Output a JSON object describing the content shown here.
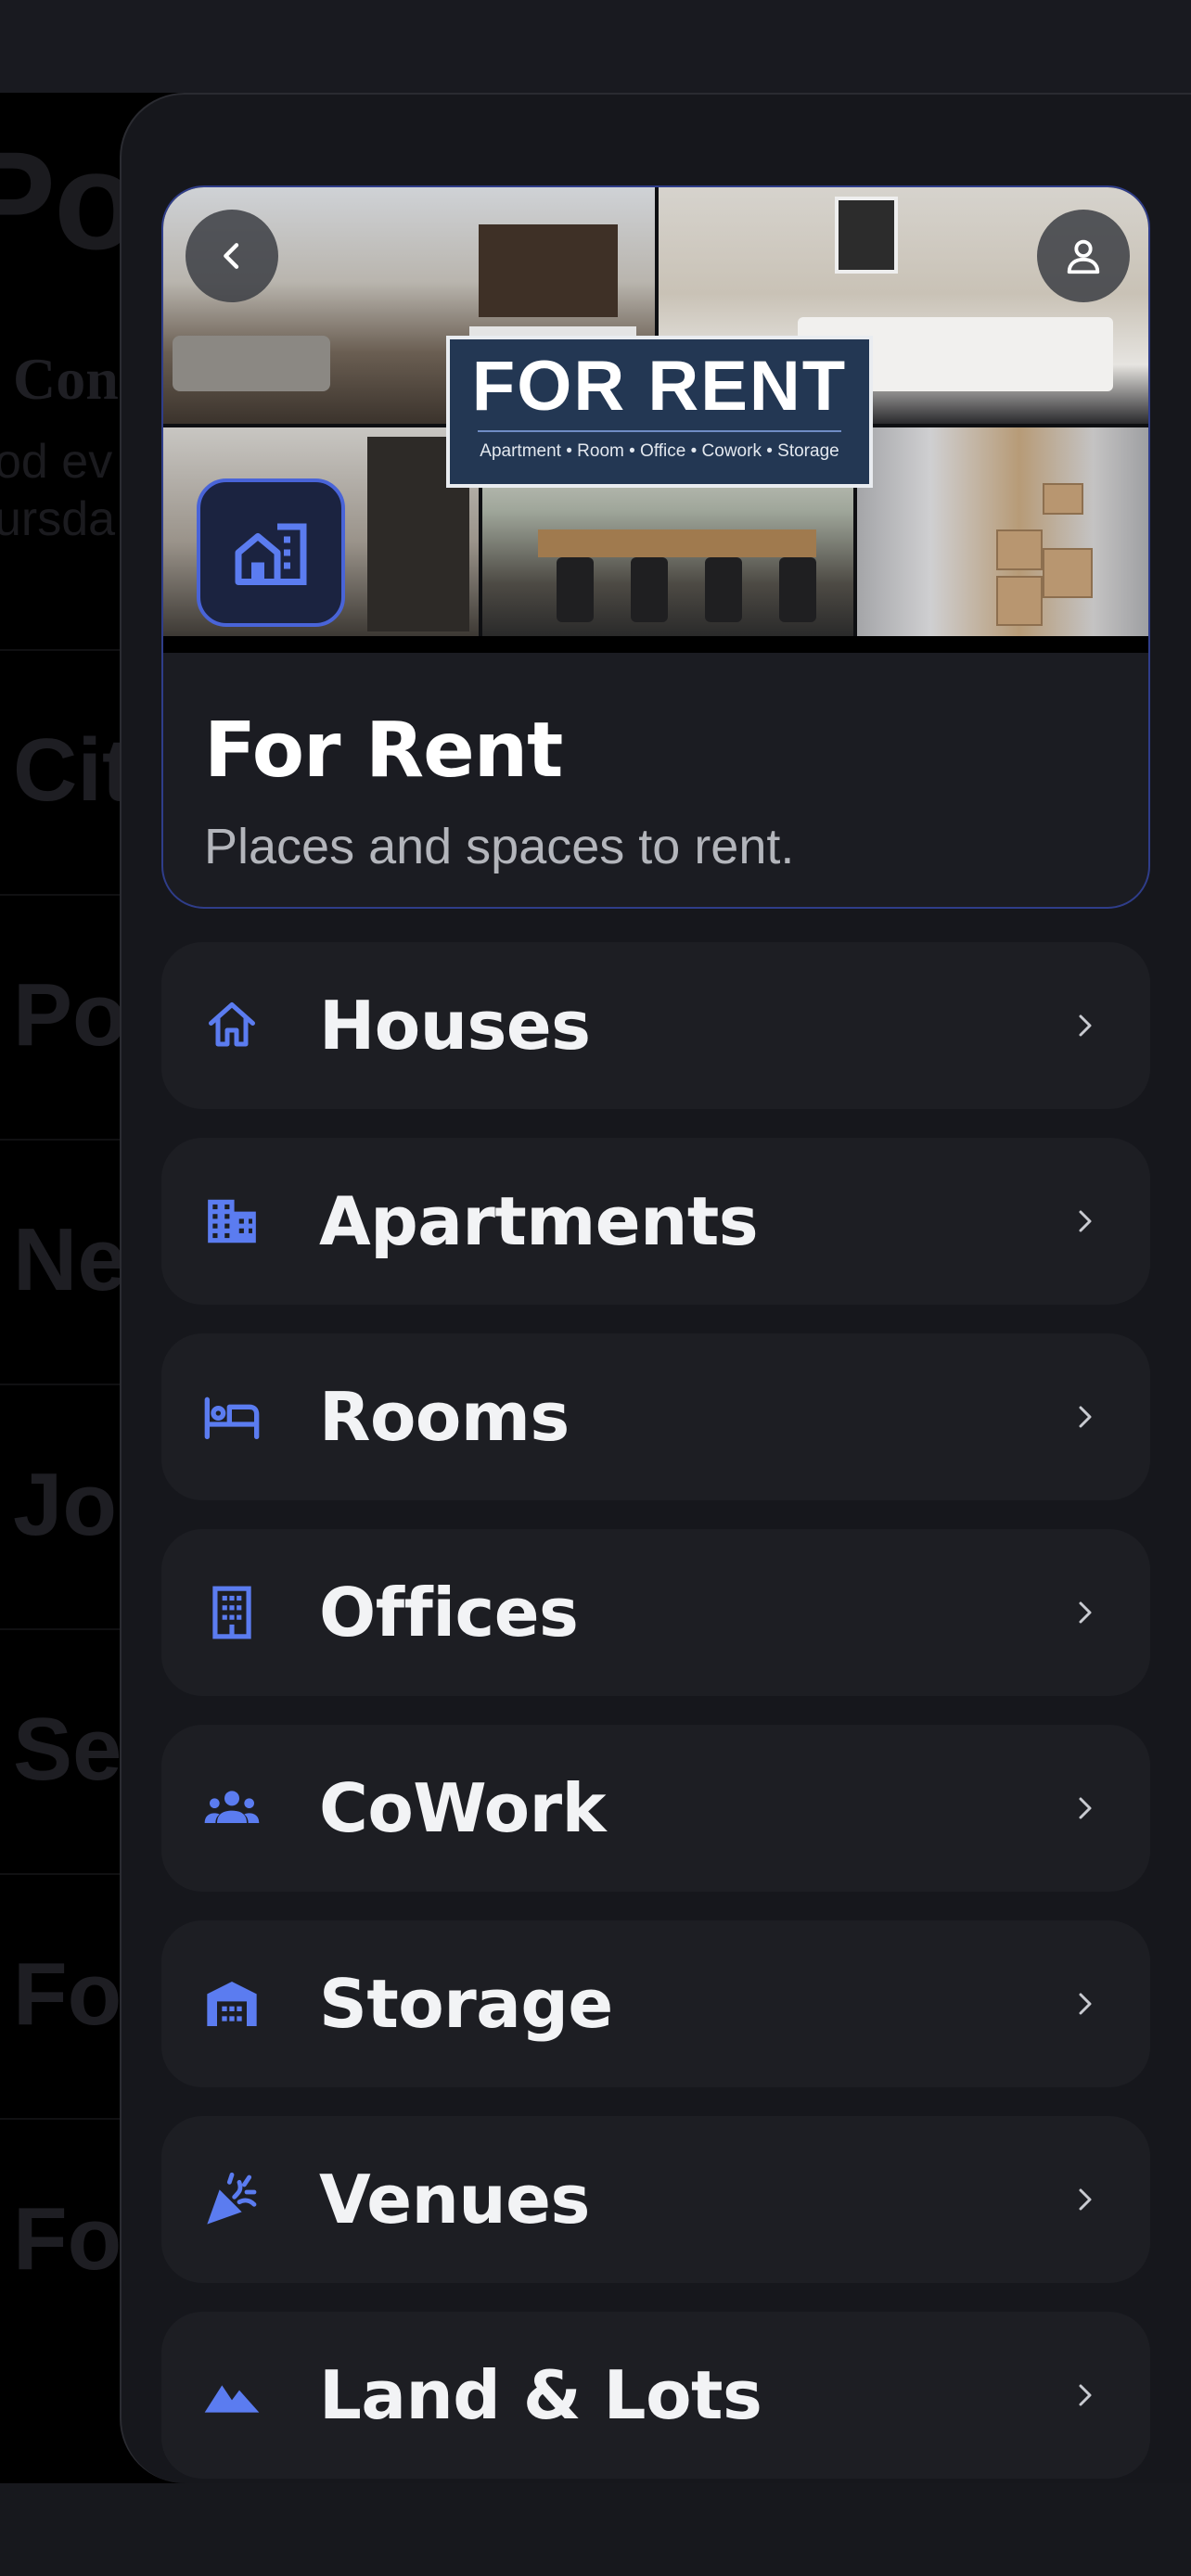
{
  "background": {
    "title_fragment": "Po",
    "sub_fragment": "Con",
    "desc_fragments": [
      "od ev",
      "ursda"
    ],
    "list_fragments": [
      "Cit",
      "Po",
      "Ne",
      "Jol",
      "Se",
      "Fo",
      "Fo"
    ]
  },
  "hero": {
    "badge_title": "FOR RENT",
    "badge_subtitle": "Apartment • Room • Office • Cowork • Storage",
    "title": "For Rent",
    "subtitle": "Places and spaces to rent."
  },
  "colors": {
    "accent": "#5b7cf0",
    "panel": "#16171c",
    "card": "#1d1e23",
    "hero_border": "#2f3d8a",
    "text_primary": "#f2f3f5",
    "text_secondary": "#b3b5bb"
  },
  "menu": {
    "items": [
      {
        "label": "Houses",
        "icon": "house-icon"
      },
      {
        "label": "Apartments",
        "icon": "building-icon"
      },
      {
        "label": "Rooms",
        "icon": "bed-icon"
      },
      {
        "label": "Offices",
        "icon": "office-building-icon"
      },
      {
        "label": "CoWork",
        "icon": "group-icon"
      },
      {
        "label": "Storage",
        "icon": "warehouse-icon"
      },
      {
        "label": "Venues",
        "icon": "party-popper-icon"
      },
      {
        "label": "Land & Lots",
        "icon": "landscape-icon"
      }
    ]
  }
}
